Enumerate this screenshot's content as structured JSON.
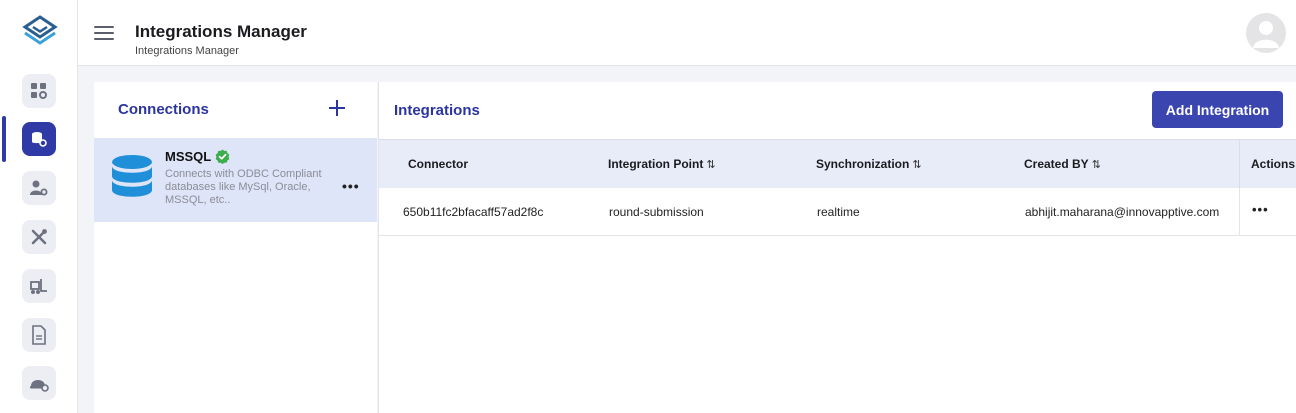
{
  "header": {
    "title": "Integrations Manager",
    "subtitle": "Integrations Manager"
  },
  "rail": {
    "items": [
      {
        "icon": "dashboard-settings-icon",
        "active": false
      },
      {
        "icon": "database-settings-icon",
        "active": true
      },
      {
        "icon": "user-settings-icon",
        "active": false
      },
      {
        "icon": "tools-icon",
        "active": false
      },
      {
        "icon": "forklift-icon",
        "active": false
      },
      {
        "icon": "document-icon",
        "active": false
      },
      {
        "icon": "worker-helmet-icon",
        "active": false
      }
    ]
  },
  "connections": {
    "title": "Connections",
    "items": [
      {
        "name": "MSSQL",
        "description": "Connects with ODBC Compliant databases like MySql, Oracle, MSSQL, etc..",
        "verified": true
      }
    ]
  },
  "integrations": {
    "title": "Integrations",
    "add_button": "Add Integration",
    "columns": [
      "Connector",
      "Integration Point",
      "Synchronization",
      "Created BY",
      "Actions"
    ],
    "sort_glyph": "⇅",
    "rows": [
      {
        "connector": "650b11fc2bfacaff57ad2f8c",
        "integration_point": "round-submission",
        "synchronization": "realtime",
        "created_by": "abhijit.maharana@innovapptive.com"
      }
    ]
  },
  "colors": {
    "accent": "#2b35a0",
    "button": "#3b45b0",
    "selected_card": "#dfe5f9",
    "table_header": "#e8ecf8",
    "verified": "#3cae4e",
    "db_icon": "#1e8fd8"
  }
}
